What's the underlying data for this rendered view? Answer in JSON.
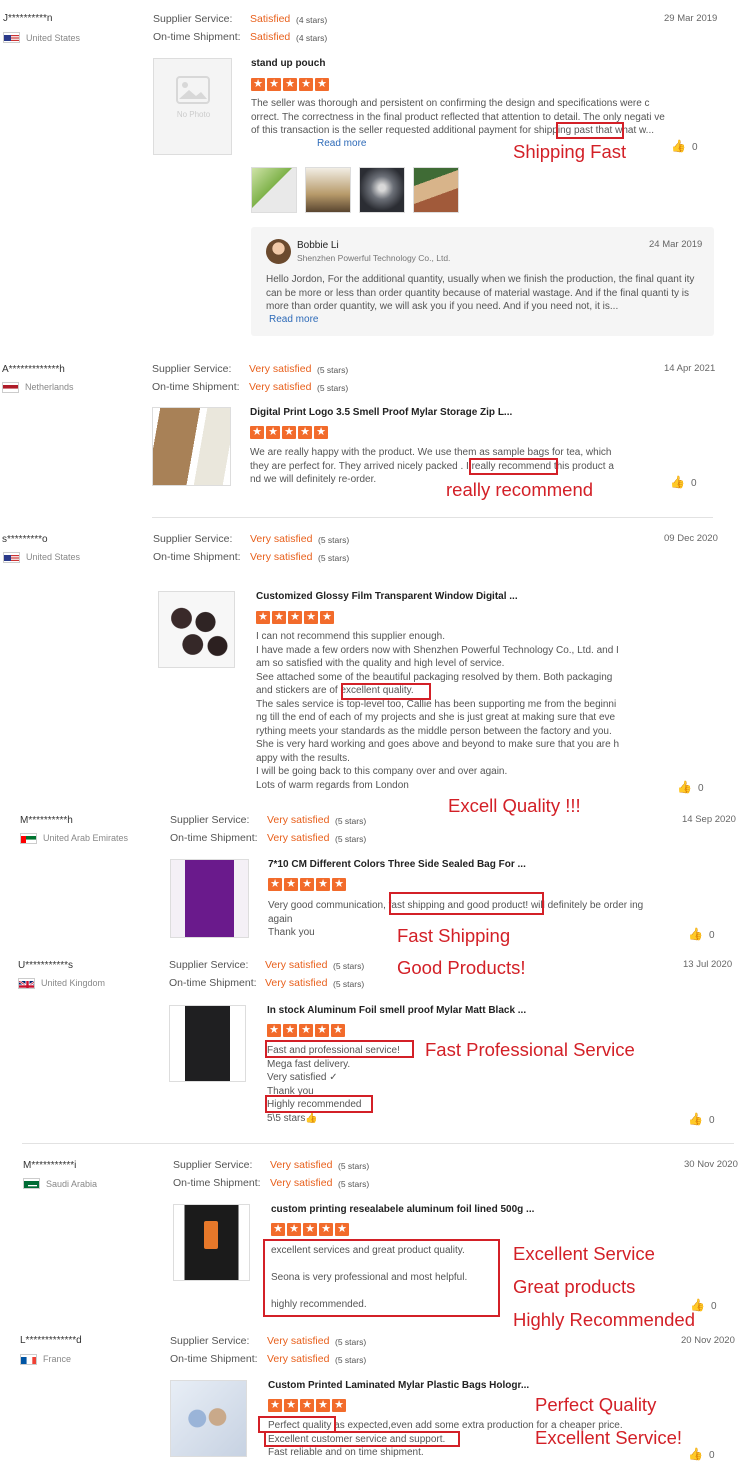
{
  "labels": {
    "supplier_service": "Supplier Service:",
    "ontime_shipment": "On-time Shipment:",
    "read_more": "Read more",
    "like_count": "0"
  },
  "colors": {
    "accent": "#e8601c",
    "annotation": "#d32027",
    "link": "#2d6ab8"
  },
  "reviews": [
    {
      "user": "J**********n",
      "country": "United States",
      "date": "29 Mar 2019",
      "supplier_service": "Satisfied",
      "supplier_stars": "(4 stars)",
      "shipment": "Satisfied",
      "shipment_stars": "(4 stars)",
      "product": "stand up pouch",
      "no_photo": "No Photo",
      "rating": 5,
      "body": "The seller was thorough and persistent on confirming the design and specifications were c orrect. The correctness in the final product reflected that attention to detail. The only negati ve of this transaction is the seller requested additional payment for shipping past that what w...",
      "annotation": "Shipping Fast",
      "reply": {
        "name": "Bobbie Li",
        "company": "Shenzhen Powerful Technology Co., Ltd.",
        "date": "24 Mar 2019",
        "body": "Hello Jordon, For the additional quantity, usually when we finish the production, the final quant ity can be more or less than order quantity because of material wastage. And if the final quanti ty is more than order quantity, we will ask you if you need. And if you need not, it is..."
      }
    },
    {
      "user": "A*************h",
      "country": "Netherlands",
      "date": "14 Apr 2021",
      "supplier_service": "Very satisfied",
      "supplier_stars": "(5 stars)",
      "shipment": "Very satisfied",
      "shipment_stars": "(5 stars)",
      "product": "Digital Print Logo 3.5 Smell Proof Mylar Storage Zip L...",
      "rating": 5,
      "body": "We are really happy with the product. We use them as sample bags for tea, which they are perfect for. They arrived nicely packed . I really recommend this product a nd we will definitely re-order.",
      "annotation": "really recommend"
    },
    {
      "user": "s*********o",
      "country": "United States",
      "date": "09 Dec 2020",
      "supplier_service": "Very satisfied",
      "supplier_stars": "(5 stars)",
      "shipment": "Very satisfied",
      "shipment_stars": "(5 stars)",
      "product": "Customized Glossy Film Transparent Window Digital ...",
      "rating": 5,
      "body": "I can not recommend this supplier enough.\nI have made a few orders now with Shenzhen Powerful Technology Co., Ltd. and I am so satisfied with the quality and high level of service.\nSee attached some of the beautiful packaging resolved by them. Both packaging and stickers are of excellent quality.\nThe sales service is top-level too, Callie has been supporting me from the beginni ng till the end of each of my projects and she is just great at making sure that eve rything meets your standards as the middle person between the factory and you. She is very hard working and goes above and beyond to make sure that you are h appy with the results.\nI will be going back to this company over and over again.\nLots of warm regards from London",
      "annotation": "Excell Quality !!!"
    },
    {
      "user": "M**********h",
      "country": "United Arab Emirates",
      "date": "14 Sep 2020",
      "supplier_service": "Very satisfied",
      "supplier_stars": "(5 stars)",
      "shipment": "Very satisfied",
      "shipment_stars": "(5 stars)",
      "product": "7*10 CM Different Colors Three Side Sealed Bag For ...",
      "rating": 5,
      "body": "Very good communication, fast shipping and good product! will definitely be order ing again\nThank you",
      "annotation": "Fast Shipping",
      "annotation2": "Good Products!"
    },
    {
      "user": "U***********s",
      "country": "United Kingdom",
      "date": "13 Jul 2020",
      "supplier_service": "Very satisfied",
      "supplier_stars": "(5 stars)",
      "shipment": "Very satisfied",
      "shipment_stars": "(5 stars)",
      "product": "In stock Aluminum Foil smell proof Mylar Matt Black ...",
      "rating": 5,
      "body": "Fast and professional service!\nMega fast delivery.\nVery satisfied ✓\nThank you\nHighly recommended\n5\\5 stars👍",
      "annotation": "Fast Professional Service"
    },
    {
      "user": "M***********i",
      "country": "Saudi Arabia",
      "date": "30 Nov 2020",
      "supplier_service": "Very satisfied",
      "supplier_stars": "(5 stars)",
      "shipment": "Very satisfied",
      "shipment_stars": "(5 stars)",
      "product": "custom printing resealabele aluminum foil lined 500g ...",
      "rating": 5,
      "body": "excellent services and great product quality.\n\nSeona is very professional and most helpful.\n\nhighly recommended.",
      "annotation": "Excellent Service",
      "annotation2": "Great products",
      "annotation3": "Highly Recommended"
    },
    {
      "user": "L*************d",
      "country": "France",
      "date": "20 Nov 2020",
      "supplier_service": "Very satisfied",
      "supplier_stars": "(5 stars)",
      "shipment": "Very satisfied",
      "shipment_stars": "(5 stars)",
      "product": "Custom Printed Laminated Mylar Plastic Bags Hologr...",
      "rating": 5,
      "body": "Perfect quality as expected,even add some extra production for a cheaper price.\nExcellent customer service and support.\nFast reliable and on time shipment.",
      "annotation": "Perfect Quality",
      "annotation2": "Excellent Service!"
    }
  ]
}
